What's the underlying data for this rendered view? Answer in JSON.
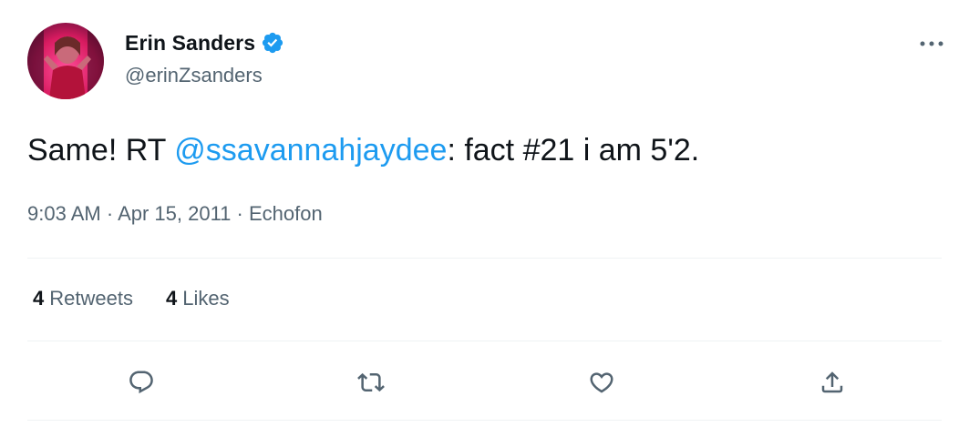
{
  "user": {
    "display_name": "Erin Sanders",
    "handle": "@erinZsanders",
    "verified": true,
    "avatar_icon": "profile-photo"
  },
  "tweet": {
    "text_before": "Same! RT ",
    "mention": "@ssavannahjaydee",
    "text_after": ": fact #21 i am 5'2."
  },
  "meta": {
    "time": "9:03 AM",
    "separator": " · ",
    "date": "Apr 15, 2011",
    "source": "Echofon"
  },
  "stats": {
    "retweets_count": "4",
    "retweets_label": "Retweets",
    "likes_count": "4",
    "likes_label": "Likes"
  },
  "actions": [
    {
      "name": "reply",
      "icon": "reply-icon"
    },
    {
      "name": "retweet",
      "icon": "retweet-icon"
    },
    {
      "name": "like",
      "icon": "heart-icon"
    },
    {
      "name": "share",
      "icon": "share-icon"
    }
  ],
  "colors": {
    "link": "#1d9bf0",
    "text": "#0f1419",
    "secondary": "#536471",
    "divider": "#eff3f4",
    "verified": "#1d9bf0"
  }
}
